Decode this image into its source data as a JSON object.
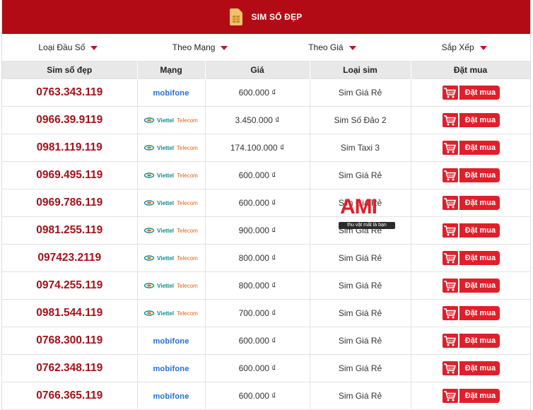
{
  "header": {
    "title": "Sim số đẹp",
    "icon": "sim-card-icon"
  },
  "filters": [
    {
      "label": "Loại Đầu Số"
    },
    {
      "label": "Theo Mạng"
    },
    {
      "label": "Theo Giá"
    },
    {
      "label": "Sắp Xếp"
    }
  ],
  "columns": [
    "Sim số đẹp",
    "Mạng",
    "Giá",
    "Loại sim",
    "Đặt mua"
  ],
  "network_logos": {
    "mobifone": {
      "text": "mobifone"
    },
    "viettel": {
      "name": "Viettel",
      "suffix": "Telecom"
    }
  },
  "buy_label": "Đặt mua",
  "rows": [
    {
      "number": "0763.343.119",
      "network": "mobifone",
      "price": "600.000 ₫",
      "type": "Sim Giá Rẻ"
    },
    {
      "number": "0966.39.9119",
      "network": "viettel",
      "price": "3.450.000 ₫",
      "type": "Sim Số Đảo 2"
    },
    {
      "number": "0981.119.119",
      "network": "viettel",
      "price": "174.100.000 ₫",
      "type": "Sim Taxi 3"
    },
    {
      "number": "0969.495.119",
      "network": "viettel",
      "price": "600.000 ₫",
      "type": "Sim Giá Rẻ"
    },
    {
      "number": "0969.786.119",
      "network": "viettel",
      "price": "600.000 ₫",
      "type": "Sim Giá Rẻ"
    },
    {
      "number": "0981.255.119",
      "network": "viettel",
      "price": "900.000 ₫",
      "type": "Sim Giá Rẻ"
    },
    {
      "number": "097423.2119",
      "network": "viettel",
      "price": "800.000 ₫",
      "type": "Sim Giá Rẻ"
    },
    {
      "number": "0974.255.119",
      "network": "viettel",
      "price": "800.000 ₫",
      "type": "Sim Giá Rẻ"
    },
    {
      "number": "0981.544.119",
      "network": "viettel",
      "price": "700.000 ₫",
      "type": "Sim Giá Rẻ"
    },
    {
      "number": "0768.300.119",
      "network": "mobifone",
      "price": "600.000 ₫",
      "type": "Sim Giá Rẻ"
    },
    {
      "number": "0762.348.119",
      "network": "mobifone",
      "price": "600.000 ₫",
      "type": "Sim Giá Rẻ"
    },
    {
      "number": "0766.365.119",
      "network": "mobifone",
      "price": "600.000 ₫",
      "type": "Sim Giá Rẻ"
    }
  ],
  "watermark": {
    "logo": "AMI",
    "tagline": "thu vặt mất là bạn"
  },
  "colors": {
    "brand_red": "#b30b16",
    "number_red": "#a3121a",
    "button_red": "#e01f2a",
    "mobifone_blue": "#1f6fd0",
    "viettel_teal": "#118a8a"
  }
}
